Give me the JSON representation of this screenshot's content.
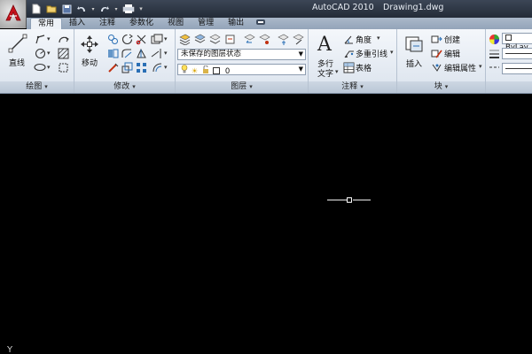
{
  "titlebar": {
    "app_name": "AutoCAD 2010",
    "file_name": "Drawing1.dwg",
    "quick_access_icons": [
      "new-icon",
      "open-icon",
      "save-icon",
      "undo-icon",
      "redo-icon",
      "plot-icon"
    ]
  },
  "tabs": [
    {
      "label": "常用",
      "active": true
    },
    {
      "label": "插入",
      "active": false
    },
    {
      "label": "注释",
      "active": false
    },
    {
      "label": "参数化",
      "active": false
    },
    {
      "label": "视图",
      "active": false
    },
    {
      "label": "管理",
      "active": false
    },
    {
      "label": "输出",
      "active": false
    }
  ],
  "panels": {
    "draw": {
      "label": "绘图",
      "line_label": "直线"
    },
    "modify": {
      "label": "修改",
      "move_label": "移动"
    },
    "layers": {
      "label": "图层",
      "layer_state": "未保存的图层状态",
      "current_layer": "0"
    },
    "annotation": {
      "label": "注释",
      "text_label_1": "多行",
      "text_label_2": "文字",
      "angle_label": "角度",
      "multileader_label": "多重引线",
      "table_label": "表格"
    },
    "block": {
      "label": "块",
      "insert_label": "插入",
      "create_label": "创建",
      "edit_label": "编辑",
      "edit_attr_label": "编辑属性"
    },
    "properties": {
      "color_value": "ByLay"
    }
  },
  "canvas": {
    "background": "#000000",
    "ucs_label": "Y"
  },
  "colors": {
    "ribbon_bg": "#e6ecf3",
    "titlebar_bg": "#2c3442",
    "crosshair": "#ffffff"
  }
}
